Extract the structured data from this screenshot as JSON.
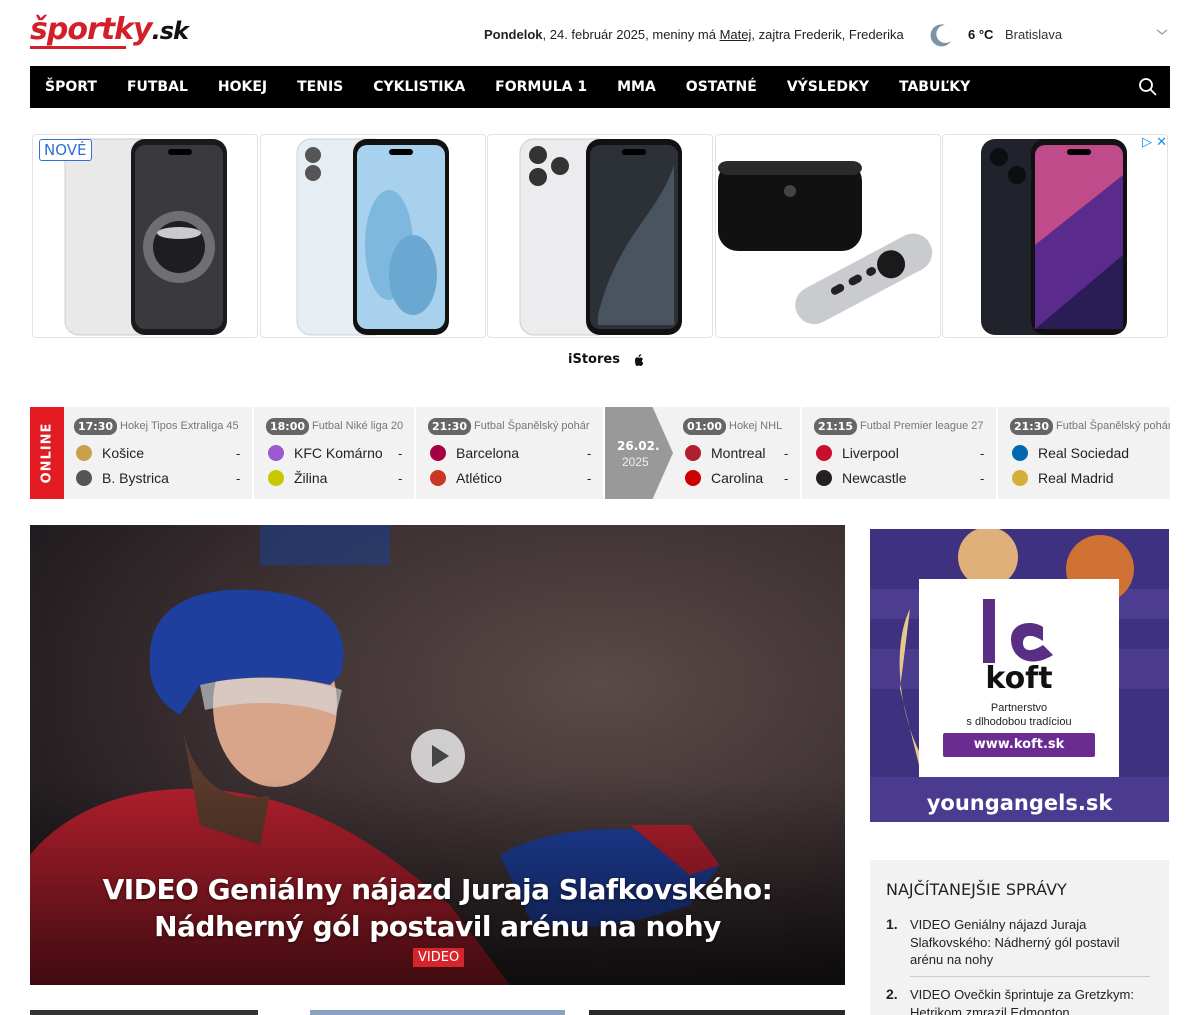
{
  "header": {
    "logo_main": "športky",
    "logo_suffix": ".sk",
    "day": "Pondelok",
    "date": ", 24. február 2025, meniny má ",
    "nameday": "Matej",
    "tomorrow": ", zajtra Frederik, Frederika",
    "temperature": "6 °C",
    "city": "Bratislava"
  },
  "nav": {
    "items": [
      "ŠPORT",
      "FUTBAL",
      "HOKEJ",
      "TENIS",
      "CYKLISTIKA",
      "FORMULA 1",
      "MMA",
      "OSTATNÉ",
      "VÝSLEDKY",
      "TABUĽKY"
    ]
  },
  "ad": {
    "badge": "NOVÉ",
    "close": "▷ ✕",
    "brand": "iStores"
  },
  "scores": {
    "online_label": "ONLINE",
    "date_day": "26.02.",
    "date_year": "2025",
    "matches": [
      {
        "time": "17:30",
        "competition": "Hokej Tipos Extraliga 45",
        "home": "Košice",
        "away": "B. Bystrica",
        "home_score": "-",
        "away_score": "-",
        "home_color": "#c9a14a",
        "away_color": "#555"
      },
      {
        "time": "18:00",
        "competition": "Futbal Niké liga 20",
        "home": "KFC Komárno",
        "away": "Žilina",
        "home_score": "-",
        "away_score": "-",
        "home_color": "#9b59d0",
        "away_color": "#c8c800"
      },
      {
        "time": "21:30",
        "competition": "Futbal Španělský pohár",
        "home": "Barcelona",
        "away": "Atlético",
        "home_score": "-",
        "away_score": "-",
        "home_color": "#a50044",
        "away_color": "#cb3524"
      },
      {
        "time": "01:00",
        "competition": "Hokej NHL",
        "home": "Montreal",
        "away": "Carolina",
        "home_score": "-",
        "away_score": "-",
        "home_color": "#af1e2d",
        "away_color": "#cc0000"
      },
      {
        "time": "21:15",
        "competition": "Futbal Premier league 27",
        "home": "Liverpool",
        "away": "Newcastle",
        "home_score": "-",
        "away_score": "-",
        "home_color": "#c8102e",
        "away_color": "#241f20"
      },
      {
        "time": "21:30",
        "competition": "Futbal Španělský pohár",
        "home": "Real Sociedad",
        "away": "Real Madrid",
        "home_score": "-",
        "away_score": "-",
        "home_color": "#0067b1",
        "away_color": "#d4af37"
      }
    ]
  },
  "hero": {
    "title": "VIDEO Geniálny nájazd Juraja Slafkovského: Nádherný gól postavil arénu na nohy",
    "badge": "VIDEO"
  },
  "side_ad": {
    "brand": "koft",
    "tagline_1": "Partnerstvo",
    "tagline_2": "s dlhodobou tradíciou",
    "button": "www.koft.sk",
    "footer": "youngangels.sk"
  },
  "mostread": {
    "heading": "NAJČÍTANEJŠIE SPRÁVY",
    "items": [
      {
        "num": "1.",
        "text": "VIDEO Geniálny nájazd Juraja Slafkovského: Nádherný gól postavil arénu na nohy"
      },
      {
        "num": "2.",
        "text": "VIDEO Ovečkin šprintuje za Gretzkym: Hetrikom zmrazil Edmonton"
      }
    ]
  }
}
